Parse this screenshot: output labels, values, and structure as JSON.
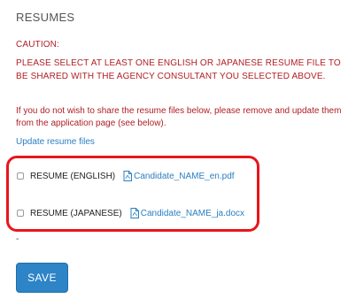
{
  "section": {
    "title": "RESUMES"
  },
  "caution": {
    "heading": "CAUTION:",
    "body": "PLEASE SELECT AT LEAST ONE ENGLISH OR JAPANESE RESUME FILE TO BE SHARED WITH THE AGENCY CONSULTANT YOU SELECTED ABOVE."
  },
  "note": {
    "text": "If you do not wish to share the resume files below, please remove and update them from the application page (see below)."
  },
  "update_link": {
    "label": "Update resume files"
  },
  "resumes": [
    {
      "label": "RESUME (ENGLISH)",
      "file": "Candidate_NAME_en.pdf",
      "icon": "pdf-file-icon",
      "checked": false
    },
    {
      "label": "RESUME (JAPANESE)",
      "file": "Candidate_NAME_ja.docx",
      "icon": "pdf-file-icon",
      "checked": false
    }
  ],
  "dash": "-",
  "save_button": {
    "label": "SAVE"
  },
  "colors": {
    "caution_red": "#b01e23",
    "link_blue": "#2a7fc1",
    "highlight_red": "#e8151b",
    "button_blue": "#2d84c7"
  }
}
